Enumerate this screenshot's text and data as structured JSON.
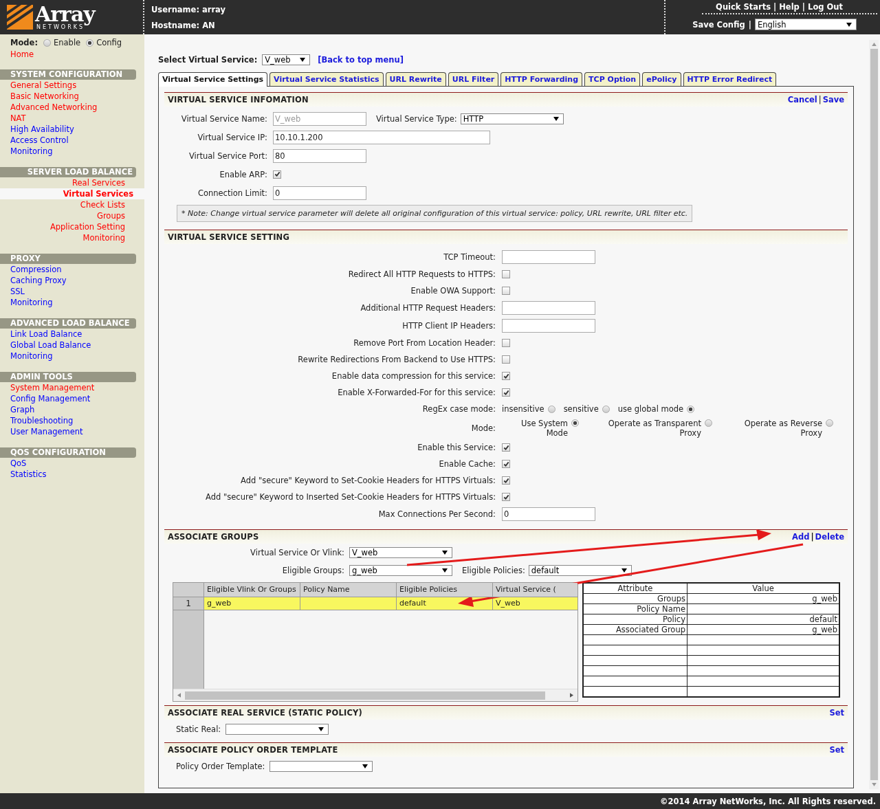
{
  "header": {
    "logo": {
      "name": "Array",
      "tagline": "NETWORKS"
    },
    "username": "Username: array",
    "hostname": "Hostname: AN",
    "links": [
      "Quick Starts",
      "Help",
      "Log Out"
    ],
    "separator": "|",
    "save_config": "Save Config",
    "language": "English"
  },
  "sidebar": {
    "mode_label": "Mode:",
    "modes": [
      {
        "label": "Enable",
        "selected": false
      },
      {
        "label": "Config",
        "selected": true
      }
    ],
    "home": "Home",
    "sections": [
      {
        "title": "SYSTEM CONFIGURATION",
        "right_aligned": false,
        "items": [
          {
            "label": "General Settings",
            "color": "#ff0000",
            "selected": false
          },
          {
            "label": "Basic Networking",
            "color": "#ff0000",
            "selected": false
          },
          {
            "label": "Advanced Networking",
            "color": "#ff0000",
            "selected": false
          },
          {
            "label": "NAT",
            "color": "#ff0000",
            "selected": false
          },
          {
            "label": "High Availability",
            "color": "#0000ff",
            "selected": false
          },
          {
            "label": "Access Control",
            "color": "#0000ff",
            "selected": false
          },
          {
            "label": "Monitoring",
            "color": "#0000ff",
            "selected": false
          }
        ]
      },
      {
        "title": "SERVER LOAD BALANCE",
        "right_aligned": true,
        "items": [
          {
            "label": "Real Services",
            "color": "#ff0000",
            "selected": false
          },
          {
            "label": "Virtual Services",
            "color": "#ff0000",
            "selected": true
          },
          {
            "label": "Check Lists",
            "color": "#ff0000",
            "selected": false
          },
          {
            "label": "Groups",
            "color": "#ff0000",
            "selected": false
          },
          {
            "label": "Application Setting",
            "color": "#ff0000",
            "selected": false
          },
          {
            "label": "Monitoring",
            "color": "#ff0000",
            "selected": false
          }
        ]
      },
      {
        "title": "PROXY",
        "right_aligned": false,
        "items": [
          {
            "label": "Compression",
            "color": "#0000ff",
            "selected": false
          },
          {
            "label": "Caching Proxy",
            "color": "#0000ff",
            "selected": false
          },
          {
            "label": "SSL",
            "color": "#0000ff",
            "selected": false
          },
          {
            "label": "Monitoring",
            "color": "#0000ff",
            "selected": false
          }
        ]
      },
      {
        "title": "ADVANCED LOAD BALANCE",
        "right_aligned": false,
        "items": [
          {
            "label": "Link Load Balance",
            "color": "#0000ff",
            "selected": false
          },
          {
            "label": "Global Load Balance",
            "color": "#0000ff",
            "selected": false
          },
          {
            "label": "Monitoring",
            "color": "#0000ff",
            "selected": false
          }
        ]
      },
      {
        "title": "ADMIN TOOLS",
        "right_aligned": false,
        "items": [
          {
            "label": "System Management",
            "color": "#ff0000",
            "selected": false
          },
          {
            "label": "Config Management",
            "color": "#0000ff",
            "selected": false
          },
          {
            "label": "Graph",
            "color": "#0000ff",
            "selected": false
          },
          {
            "label": "Troubleshooting",
            "color": "#0000ff",
            "selected": false
          },
          {
            "label": "User Management",
            "color": "#0000ff",
            "selected": false
          }
        ]
      },
      {
        "title": "QOS CONFIGURATION",
        "right_aligned": false,
        "items": [
          {
            "label": "QoS",
            "color": "#0000ff",
            "selected": false
          },
          {
            "label": "Statistics",
            "color": "#0000ff",
            "selected": false
          }
        ]
      }
    ]
  },
  "service_select": {
    "label": "Select Virtual Service:",
    "value": "V_web",
    "back_link": "[Back to top menu]"
  },
  "tabs": [
    {
      "label": "Virtual Service Settings",
      "selected": true
    },
    {
      "label": "Virtual Service Statistics",
      "selected": false
    },
    {
      "label": "URL Rewrite",
      "selected": false
    },
    {
      "label": "URL Filter",
      "selected": false
    },
    {
      "label": "HTTP Forwarding",
      "selected": false
    },
    {
      "label": "TCP Option",
      "selected": false
    },
    {
      "label": "ePolicy",
      "selected": false
    },
    {
      "label": "HTTP Error Redirect",
      "selected": false
    }
  ],
  "info": {
    "title": "VIRTUAL SERVICE INFOMATION",
    "actions": [
      "Cancel",
      "Save"
    ],
    "separator": "|",
    "rows": [
      [
        {
          "label": "Virtual Service Name:",
          "kind": "text",
          "value": "V_web",
          "disabled": true
        },
        {
          "label": "Virtual Service Type:",
          "kind": "select",
          "value": "HTTP"
        }
      ],
      [
        {
          "label": "Virtual Service IP:",
          "kind": "wide_text",
          "value": "10.10.1.200",
          "disabled": false
        }
      ],
      [
        {
          "label": "Virtual Service Port:",
          "kind": "text",
          "value": "80",
          "disabled": false
        }
      ],
      [
        {
          "label": "Enable ARP:",
          "kind": "checkbox",
          "checked": true
        }
      ],
      [
        {
          "label": "Connection Limit:",
          "kind": "text",
          "value": "0",
          "disabled": false
        }
      ]
    ],
    "note": "* Note: Change virtual service parameter will delete all original configuration of this virtual service: policy, URL rewrite, URL filter etc."
  },
  "settings": {
    "title": "VIRTUAL SERVICE SETTING",
    "rows": [
      {
        "label": "TCP Timeout:",
        "kind": "text"
      },
      {
        "label": "Redirect All HTTP Requests to HTTPS:",
        "kind": "checkbox",
        "checked": false
      },
      {
        "label": "Enable OWA Support:",
        "kind": "checkbox",
        "checked": false
      },
      {
        "label": "Additional HTTP Request Headers:",
        "kind": "text"
      },
      {
        "label": "HTTP Client IP Headers:",
        "kind": "text"
      },
      {
        "label": "Remove Port From Location Header:",
        "kind": "checkbox",
        "checked": false
      },
      {
        "label": "Rewrite Redirections From Backend to Use HTTPS:",
        "kind": "checkbox",
        "checked": false
      },
      {
        "label": "Enable data compression for this service:",
        "kind": "checkbox",
        "checked": true
      },
      {
        "label": "Enable X-Forwarded-For for this service:",
        "kind": "checkbox",
        "checked": true
      },
      {
        "label": "RegEx case mode:",
        "kind": "radios",
        "options": [
          {
            "label": "insensitive",
            "selected": false
          },
          {
            "label": "sensitive",
            "selected": false
          },
          {
            "label": "use global mode",
            "selected": true
          }
        ]
      },
      {
        "label": "Mode:",
        "kind": "wrapped_radios",
        "options": [
          {
            "label": "Use System Mode",
            "selected": true
          },
          {
            "label": "Operate as Transparent Proxy",
            "selected": false
          },
          {
            "label": "Operate as Reverse Proxy",
            "selected": false
          }
        ]
      },
      {
        "label": "Enable this Service:",
        "kind": "checkbox",
        "checked": true
      },
      {
        "label": "Enable Cache:",
        "kind": "checkbox",
        "checked": true
      },
      {
        "label": "Add \"secure\" Keyword to Set-Cookie Headers for HTTPS Virtuals:",
        "kind": "checkbox",
        "checked": true
      },
      {
        "label": "Add \"secure\" Keyword to Inserted Set-Cookie Headers for HTTPS Virtuals:",
        "kind": "checkbox",
        "checked": true
      },
      {
        "label": "Max Connections Per Second:",
        "kind": "text",
        "value": "0"
      }
    ]
  },
  "groups": {
    "title": "ASSOCIATE GROUPS",
    "actions": [
      "Add",
      "Delete"
    ],
    "separator": "|",
    "vlink": {
      "label": "Virtual Service Or Vlink:",
      "value": "V_web"
    },
    "eligible_groups": {
      "label": "Eligible Groups:",
      "value": "g_web"
    },
    "eligible_policies": {
      "label": "Eligible Policies:",
      "value": "default"
    },
    "grid": {
      "columns": [
        "Eligible Vlink Or Groups",
        "Policy Name",
        "Eligible Policies",
        "Virtual Service ("
      ],
      "rows": [
        {
          "number": "1",
          "cells": [
            "g_web",
            null,
            "default",
            "V_web"
          ],
          "selected": true
        }
      ]
    },
    "attributes": {
      "columns": [
        "Attribute",
        "Value"
      ],
      "rows": [
        {
          "attribute": "Groups",
          "value": "g_web"
        },
        {
          "attribute": "Policy Name"
        },
        {
          "attribute": "Policy",
          "value": "default"
        },
        {
          "attribute": "Associated Group",
          "value": "g_web"
        }
      ]
    }
  },
  "static_real": {
    "title": "ASSOCIATE REAL SERVICE (STATIC POLICY)",
    "action": "Set",
    "label": "Static Real:"
  },
  "policy_order": {
    "title": "ASSOCIATE POLICY ORDER TEMPLATE",
    "action": "Set",
    "label": "Policy Order Template:"
  },
  "footer": {
    "copyright": "©2014 Array NetWorks, Inc. All Rights reserved."
  }
}
